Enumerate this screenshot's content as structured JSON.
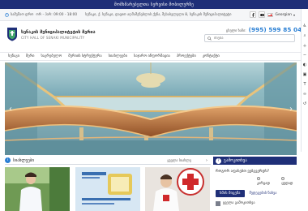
{
  "topbar": {
    "text": "მომხმარებელთა სერვისი მობილურზე"
  },
  "infobar": {
    "schedule_label": "სამუშაო დრო",
    "hours": "ორ - პარ: 09:00 - 18:00",
    "address": "სენაკი, ქ. სენაკი, დავით აღმაშენებლის ქუჩა, შესასვლელი 8, სენაკის მუნიციპალიტეტი",
    "language": "Georgian"
  },
  "header": {
    "org_name_ka": "სენაკის მუნიციპალიტეტის მერია",
    "org_name_en": "CITY HALL OF SENAKI MUNICIPALITY",
    "hotline_label": "ცხელი ხაზი:",
    "hotline_number": "(995) 599 85 04 19",
    "search_placeholder": "ძიება"
  },
  "nav": {
    "items": [
      "სენაკი",
      "მერი",
      "საკრებულო",
      "მერიის სტრუქტურა",
      "სიახლეები",
      "საჯარო ინფორმაცია",
      "პროექტები",
      "კონტაქტი"
    ]
  },
  "news": {
    "title": "სიახლეები",
    "all_label": "ყველა სიახლე"
  },
  "poll": {
    "title": "გამოკითხვა",
    "question": "როგორ აფასებთ ვებგვერდს?",
    "options": [
      "კარგად",
      "ცუდად"
    ],
    "vote_label": "ხმის მიცემა",
    "results_label": "შედეგების ნახვა",
    "more_label": "ყველა გამოკითხვა"
  },
  "colors": {
    "primary": "#1f2f78",
    "accent": "#2a7fd4"
  }
}
